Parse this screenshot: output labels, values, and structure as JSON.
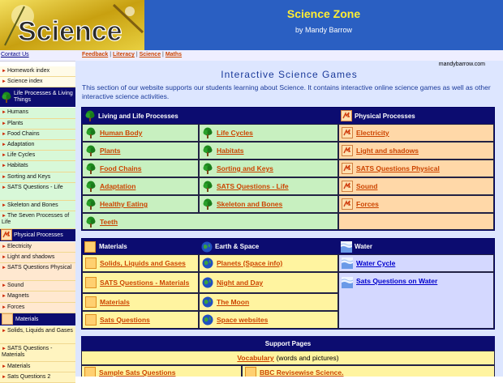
{
  "header": {
    "logo_text": "Science",
    "title": "Science Zone",
    "author": "by Mandy Barrow"
  },
  "nav": {
    "contact": "Contact Us",
    "crumbs": [
      "Feedback",
      "Literacy",
      "Science",
      "Maths"
    ],
    "sep": "|"
  },
  "sidebar": {
    "items_top": [
      "Homework index",
      "Science index"
    ],
    "life_head": "Life Processes & Living Things",
    "life_items": [
      "Humans",
      "Plants",
      "Food Chains",
      "Adaptation",
      "Life Cycles",
      "Habitats",
      "Sorting and Keys",
      "SATS Questions - Life",
      "Skeleton and Bones",
      "The Seven Processes of Life"
    ],
    "phys_head": "Physical Processes",
    "phys_items": [
      "Electricity",
      "Light and shadows",
      "SATS Questions Physical",
      "Sound",
      "Magnets",
      "Forces"
    ],
    "mat_head": "Materials",
    "mat_items": [
      "Solids, Liquids and Gases",
      "SATS Questions - Materials",
      "Materials",
      "Sats Questions 2"
    ]
  },
  "main": {
    "domain": "mandybarrow.com",
    "title": "Interactive Science Games",
    "intro": "This section of our website supports our students learning about Science. It contains interactive online science games as well as other interactive science activities."
  },
  "living": {
    "head": "Living and Life Processes",
    "col1": [
      "Human Body",
      "Plants",
      "Food Chains",
      "Adaptation",
      "Healthy Eating",
      "Teeth"
    ],
    "col2": [
      "Life Cycles",
      "Habitats",
      "Sorting and Keys",
      "SATS Questions - Life",
      "Skeleton and Bones"
    ]
  },
  "physical": {
    "head": "Physical Processes",
    "items": [
      "Electricity",
      "Light and shadows",
      "SATS Questions Physical",
      "Sound",
      "Forces"
    ]
  },
  "materials": {
    "head": "Materials",
    "items": [
      "Solids, Liquids and Gases",
      "SATS Questions - Materials",
      "Materials",
      "Sats Questions"
    ]
  },
  "earth": {
    "head": "Earth & Space",
    "items": [
      "Planets (Space info)",
      "Night and Day",
      "The Moon",
      "Space websites"
    ]
  },
  "water": {
    "head": "Water",
    "items": [
      "Water Cycle",
      "Sats Questions on Water"
    ]
  },
  "support": {
    "head": "Support Pages",
    "vocab_link": "Vocabulary",
    "vocab_note": "(words and pictures)",
    "row2_left": "Sample Sats Questions",
    "row2_right": "BBC Revisewise Science."
  },
  "colors": {
    "header_blue": "#2a5fc2",
    "title_yellow": "#ffee33",
    "panel_navy": "#0c0c70",
    "link_orange": "#cc4400",
    "living_green": "#c8f0c0",
    "physical_orange": "#ffd8a8",
    "materials_yellow": "#fff4a0",
    "water_lavender": "#d4d8ff"
  },
  "icons": [
    "tree-icon",
    "lightning-icon",
    "materials-box-icon",
    "globe-icon",
    "water-wave-icon",
    "arrow-bullet-icon"
  ]
}
